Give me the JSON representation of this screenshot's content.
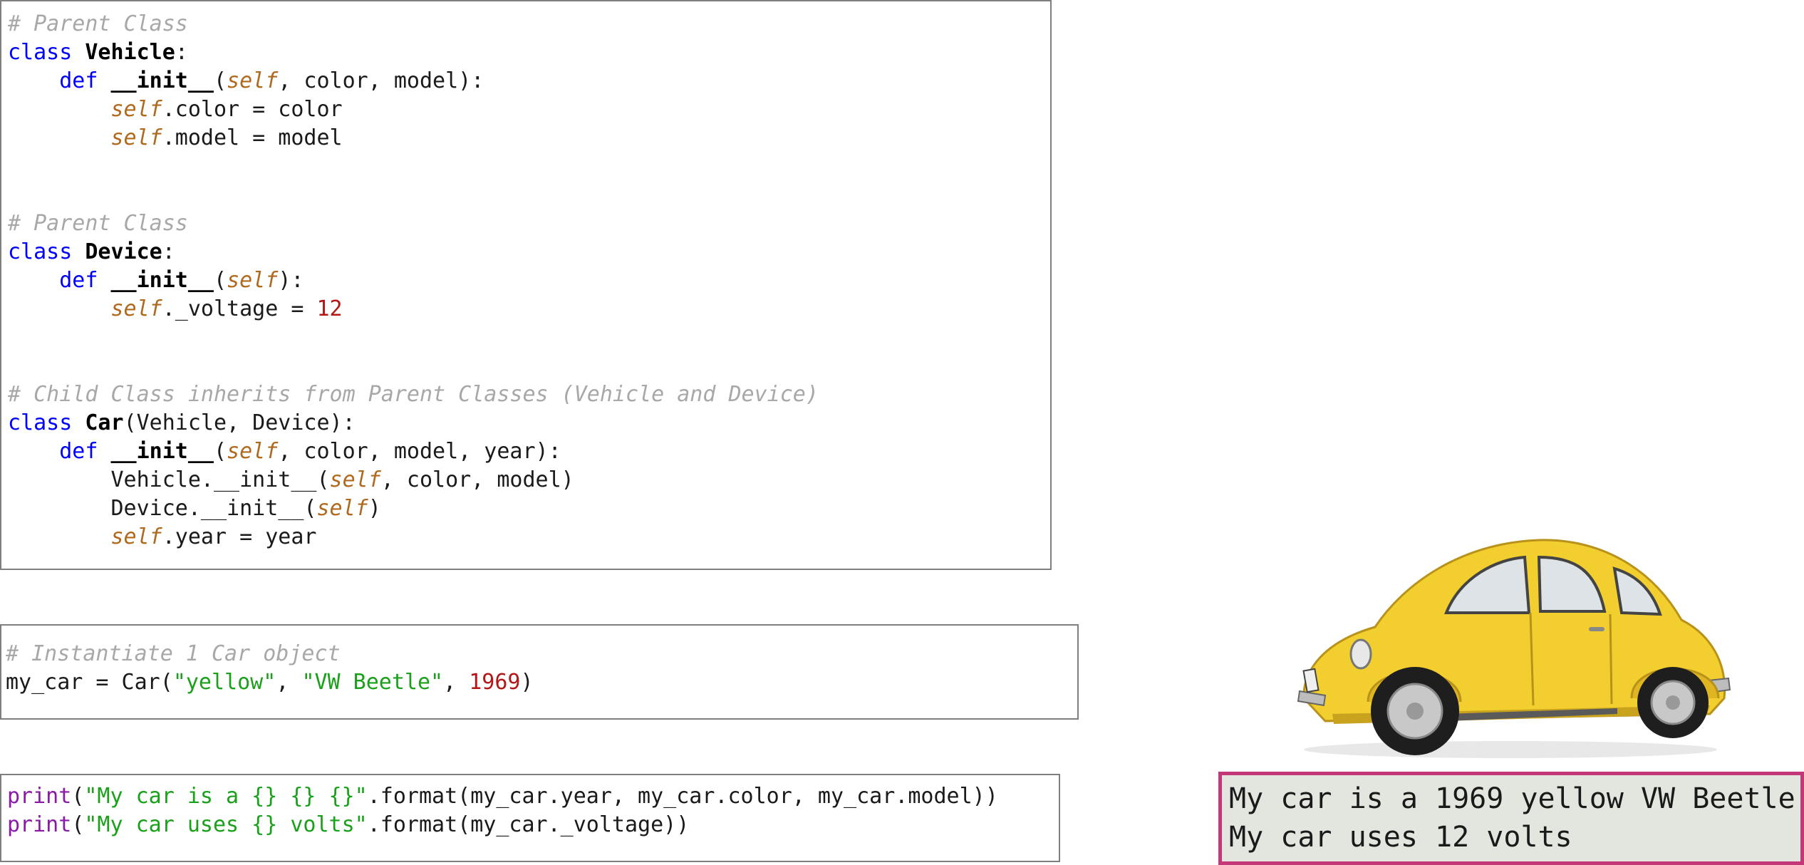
{
  "cell_classes": {
    "lines": [
      [
        {
          "c": "comment",
          "t": "# Parent Class"
        }
      ],
      [
        {
          "c": "keyword",
          "t": "class"
        },
        {
          "c": "plain",
          "t": " "
        },
        {
          "c": "classname",
          "t": "Vehicle"
        },
        {
          "c": "plain",
          "t": ":"
        }
      ],
      [
        {
          "c": "plain",
          "t": "    "
        },
        {
          "c": "keyword",
          "t": "def"
        },
        {
          "c": "plain",
          "t": " "
        },
        {
          "c": "funcname",
          "t": "__init__"
        },
        {
          "c": "plain",
          "t": "("
        },
        {
          "c": "self",
          "t": "self"
        },
        {
          "c": "plain",
          "t": ", color, model):"
        }
      ],
      [
        {
          "c": "plain",
          "t": "        "
        },
        {
          "c": "self",
          "t": "self"
        },
        {
          "c": "plain",
          "t": ".color = color"
        }
      ],
      [
        {
          "c": "plain",
          "t": "        "
        },
        {
          "c": "self",
          "t": "self"
        },
        {
          "c": "plain",
          "t": ".model = model"
        }
      ],
      [],
      [],
      [
        {
          "c": "comment",
          "t": "# Parent Class"
        }
      ],
      [
        {
          "c": "keyword",
          "t": "class"
        },
        {
          "c": "plain",
          "t": " "
        },
        {
          "c": "classname",
          "t": "Device"
        },
        {
          "c": "plain",
          "t": ":"
        }
      ],
      [
        {
          "c": "plain",
          "t": "    "
        },
        {
          "c": "keyword",
          "t": "def"
        },
        {
          "c": "plain",
          "t": " "
        },
        {
          "c": "funcname",
          "t": "__init__"
        },
        {
          "c": "plain",
          "t": "("
        },
        {
          "c": "self",
          "t": "self"
        },
        {
          "c": "plain",
          "t": "):"
        }
      ],
      [
        {
          "c": "plain",
          "t": "        "
        },
        {
          "c": "self",
          "t": "self"
        },
        {
          "c": "plain",
          "t": "._voltage = "
        },
        {
          "c": "number",
          "t": "12"
        }
      ],
      [],
      [],
      [
        {
          "c": "comment",
          "t": "# Child Class inherits from Parent Classes (Vehicle and Device)"
        }
      ],
      [
        {
          "c": "keyword",
          "t": "class"
        },
        {
          "c": "plain",
          "t": " "
        },
        {
          "c": "classname",
          "t": "Car"
        },
        {
          "c": "plain",
          "t": "(Vehicle, Device):"
        }
      ],
      [
        {
          "c": "plain",
          "t": "    "
        },
        {
          "c": "keyword",
          "t": "def"
        },
        {
          "c": "plain",
          "t": " "
        },
        {
          "c": "funcname",
          "t": "__init__"
        },
        {
          "c": "plain",
          "t": "("
        },
        {
          "c": "self",
          "t": "self"
        },
        {
          "c": "plain",
          "t": ", color, model, year):"
        }
      ],
      [
        {
          "c": "plain",
          "t": "        Vehicle.__init__("
        },
        {
          "c": "self",
          "t": "self"
        },
        {
          "c": "plain",
          "t": ", color, model)"
        }
      ],
      [
        {
          "c": "plain",
          "t": "        Device.__init__("
        },
        {
          "c": "self",
          "t": "self"
        },
        {
          "c": "plain",
          "t": ")"
        }
      ],
      [
        {
          "c": "plain",
          "t": "        "
        },
        {
          "c": "self",
          "t": "self"
        },
        {
          "c": "plain",
          "t": ".year = year"
        }
      ]
    ]
  },
  "cell_instantiate": {
    "lines": [
      [
        {
          "c": "comment",
          "t": "# Instantiate 1 Car object"
        }
      ],
      [
        {
          "c": "plain",
          "t": "my_car = Car("
        },
        {
          "c": "string",
          "t": "\"yellow\""
        },
        {
          "c": "plain",
          "t": ", "
        },
        {
          "c": "string",
          "t": "\"VW Beetle\""
        },
        {
          "c": "plain",
          "t": ", "
        },
        {
          "c": "number",
          "t": "1969"
        },
        {
          "c": "plain",
          "t": ")"
        }
      ]
    ]
  },
  "cell_print": {
    "lines": [
      [
        {
          "c": "builtin",
          "t": "print"
        },
        {
          "c": "plain",
          "t": "("
        },
        {
          "c": "string",
          "t": "\"My car is a {} {} {}\""
        },
        {
          "c": "plain",
          "t": ".format(my_car.year, my_car.color, my_car.model))"
        }
      ],
      [
        {
          "c": "builtin",
          "t": "print"
        },
        {
          "c": "plain",
          "t": "("
        },
        {
          "c": "string",
          "t": "\"My car uses {} volts\""
        },
        {
          "c": "plain",
          "t": ".format(my_car._voltage))"
        }
      ]
    ]
  },
  "output": {
    "line1": "My car is a 1969 yellow VW Beetle",
    "line2": "My car uses 12 volts"
  },
  "colors": {
    "comment": "#a8a8a8",
    "keyword": "#0000ff",
    "self": "#b06a1f",
    "number": "#b21818",
    "string": "#1aa01a",
    "builtin": "#8a1aa8",
    "output_border": "#c4387a",
    "output_background": "#e3e6df",
    "car_body": "#f2cf2e"
  },
  "image": {
    "icon": "yellow-vw-beetle-car-image"
  }
}
